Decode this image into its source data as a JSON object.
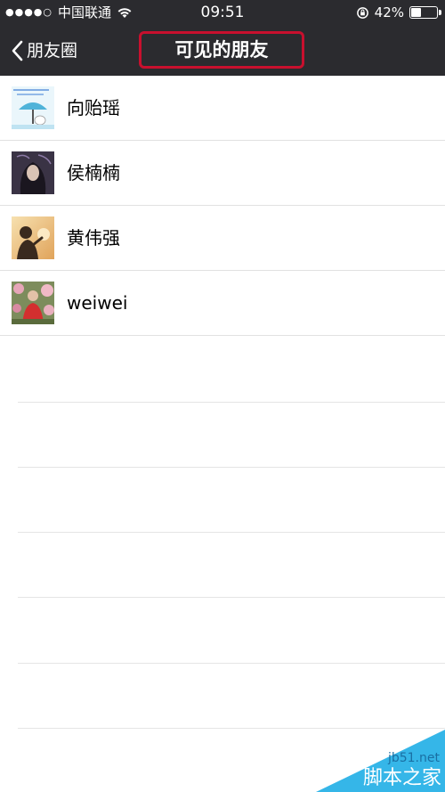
{
  "status_bar": {
    "signal": "●●●●○",
    "carrier": "中国联通",
    "time": "09:51",
    "battery_percent": "42%",
    "battery_level": 0.42
  },
  "nav": {
    "back_label": "朋友圈",
    "title": "可见的朋友"
  },
  "friends": [
    {
      "name": "向贻瑶",
      "avatar": "cartoon-umbrella-avatar"
    },
    {
      "name": "侯楠楠",
      "avatar": "dark-portrait-avatar"
    },
    {
      "name": "黄伟强",
      "avatar": "sunset-silhouette-avatar"
    },
    {
      "name": "weiwei",
      "avatar": "flowers-person-avatar"
    }
  ],
  "watermark": {
    "site": "jb51.net",
    "brand": "脚本之家"
  },
  "colors": {
    "bar_bg": "#2b2b2f",
    "highlight_border": "#c8102e",
    "separator": "#e1e1e1",
    "watermark_blue": "#35b6e8"
  }
}
